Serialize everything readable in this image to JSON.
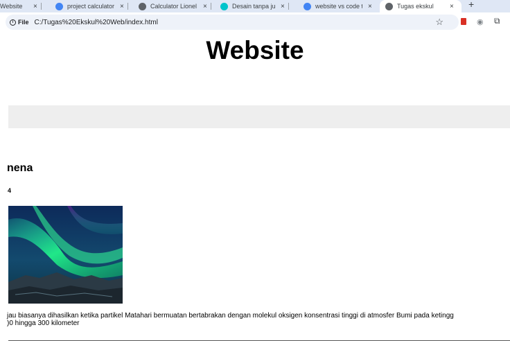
{
  "browser": {
    "tabs": [
      {
        "title": "Website",
        "favicon_color": "#e8710a"
      },
      {
        "title": "project calculator",
        "favicon_color": "#4285f4"
      },
      {
        "title": "Calculator Lionel",
        "favicon_color": "#5f6368"
      },
      {
        "title": "Desain tanpa judul",
        "favicon_color": "#00c4cc"
      },
      {
        "title": "website vs code ta",
        "favicon_color": "#4285f4"
      },
      {
        "title": "Tugas ekskul",
        "favicon_color": "#5f6368"
      }
    ],
    "tab_close": "×",
    "new_tab": "+",
    "omnibox": {
      "chip_icon": "i",
      "chip_label": "File",
      "url": "C:/Tugas%20Ekskul%20Web/index.html"
    },
    "star": "☆",
    "extensions": {
      "globe": "◉",
      "puzzle": "⧉"
    }
  },
  "page": {
    "title": "Website",
    "section_heading": "nena",
    "section_subheading": "4",
    "description_lines": [
      "jau biasanya dihasilkan ketika partikel Matahari bermuatan bertabrakan dengan molekul oksigen konsentrasi tinggi di atmosfer Bumi pada ketingg",
      ")0 hingga 300 kilometer"
    ]
  }
}
